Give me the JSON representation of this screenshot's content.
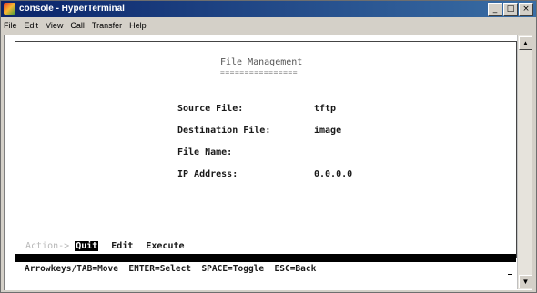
{
  "window": {
    "title": "console - HyperTerminal",
    "minimize_glyph": "_",
    "maximize_glyph": "□",
    "close_glyph": "×"
  },
  "menu": [
    "File",
    "Edit",
    "View",
    "Call",
    "Transfer",
    "Help"
  ],
  "screen": {
    "title": "File Management",
    "title_underline": "================",
    "fields": [
      {
        "label": "Source File:",
        "value": "tftp"
      },
      {
        "label": "Destination File:",
        "value": "image"
      },
      {
        "label": "File Name:",
        "value": ""
      },
      {
        "label": "IP Address:",
        "value": "0.0.0.0"
      }
    ],
    "action_label": "Action-> ",
    "actions": [
      "Quit",
      "Edit",
      "Execute"
    ],
    "selected_action": "Quit",
    "help_line": "Arrowkeys/TAB=Move  ENTER=Select  SPACE=Toggle  ESC=Back"
  },
  "scrollbar": {
    "up_glyph": "▲",
    "down_glyph": "▼"
  },
  "icons": {
    "app": "hyperterminal-icon"
  }
}
